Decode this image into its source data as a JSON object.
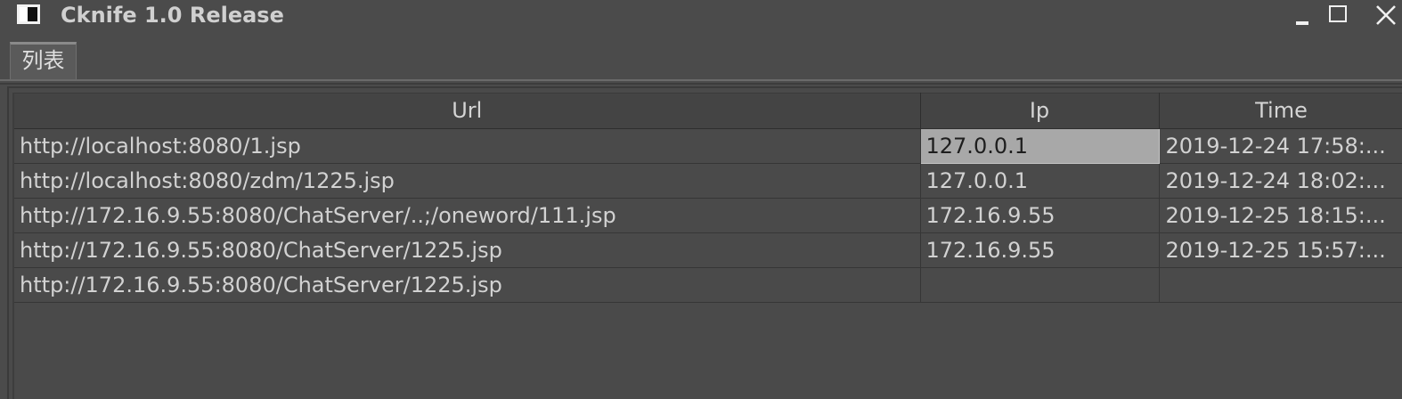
{
  "window": {
    "title": "Cknife 1.0 Release",
    "controls": {
      "minimize": "minimize-icon",
      "maximize": "maximize-icon",
      "close": "close-icon"
    }
  },
  "tabs": [
    {
      "label": "列表",
      "active": true
    }
  ],
  "table": {
    "columns": [
      "Url",
      "Ip",
      "Time"
    ],
    "rows": [
      {
        "url": "http://localhost:8080/1.jsp",
        "ip": "127.0.0.1",
        "time": "2019-12-24 17:58:..."
      },
      {
        "url": "http://localhost:8080/zdm/1225.jsp",
        "ip": "127.0.0.1",
        "time": "2019-12-24 18:02:..."
      },
      {
        "url": "http://172.16.9.55:8080/ChatServer/..;/oneword/111.jsp",
        "ip": "172.16.9.55",
        "time": "2019-12-25 18:15:..."
      },
      {
        "url": "http://172.16.9.55:8080/ChatServer/1225.jsp",
        "ip": "172.16.9.55",
        "time": "2019-12-25 15:57:..."
      },
      {
        "url": "http://172.16.9.55:8080/ChatServer/1225.jsp",
        "ip": "",
        "time": ""
      }
    ],
    "selected_cell": {
      "row": 0,
      "column": "Ip"
    }
  },
  "colors": {
    "background": "#4b4b4b",
    "text": "#d2d2d2",
    "selection": "#a8a8a8"
  }
}
